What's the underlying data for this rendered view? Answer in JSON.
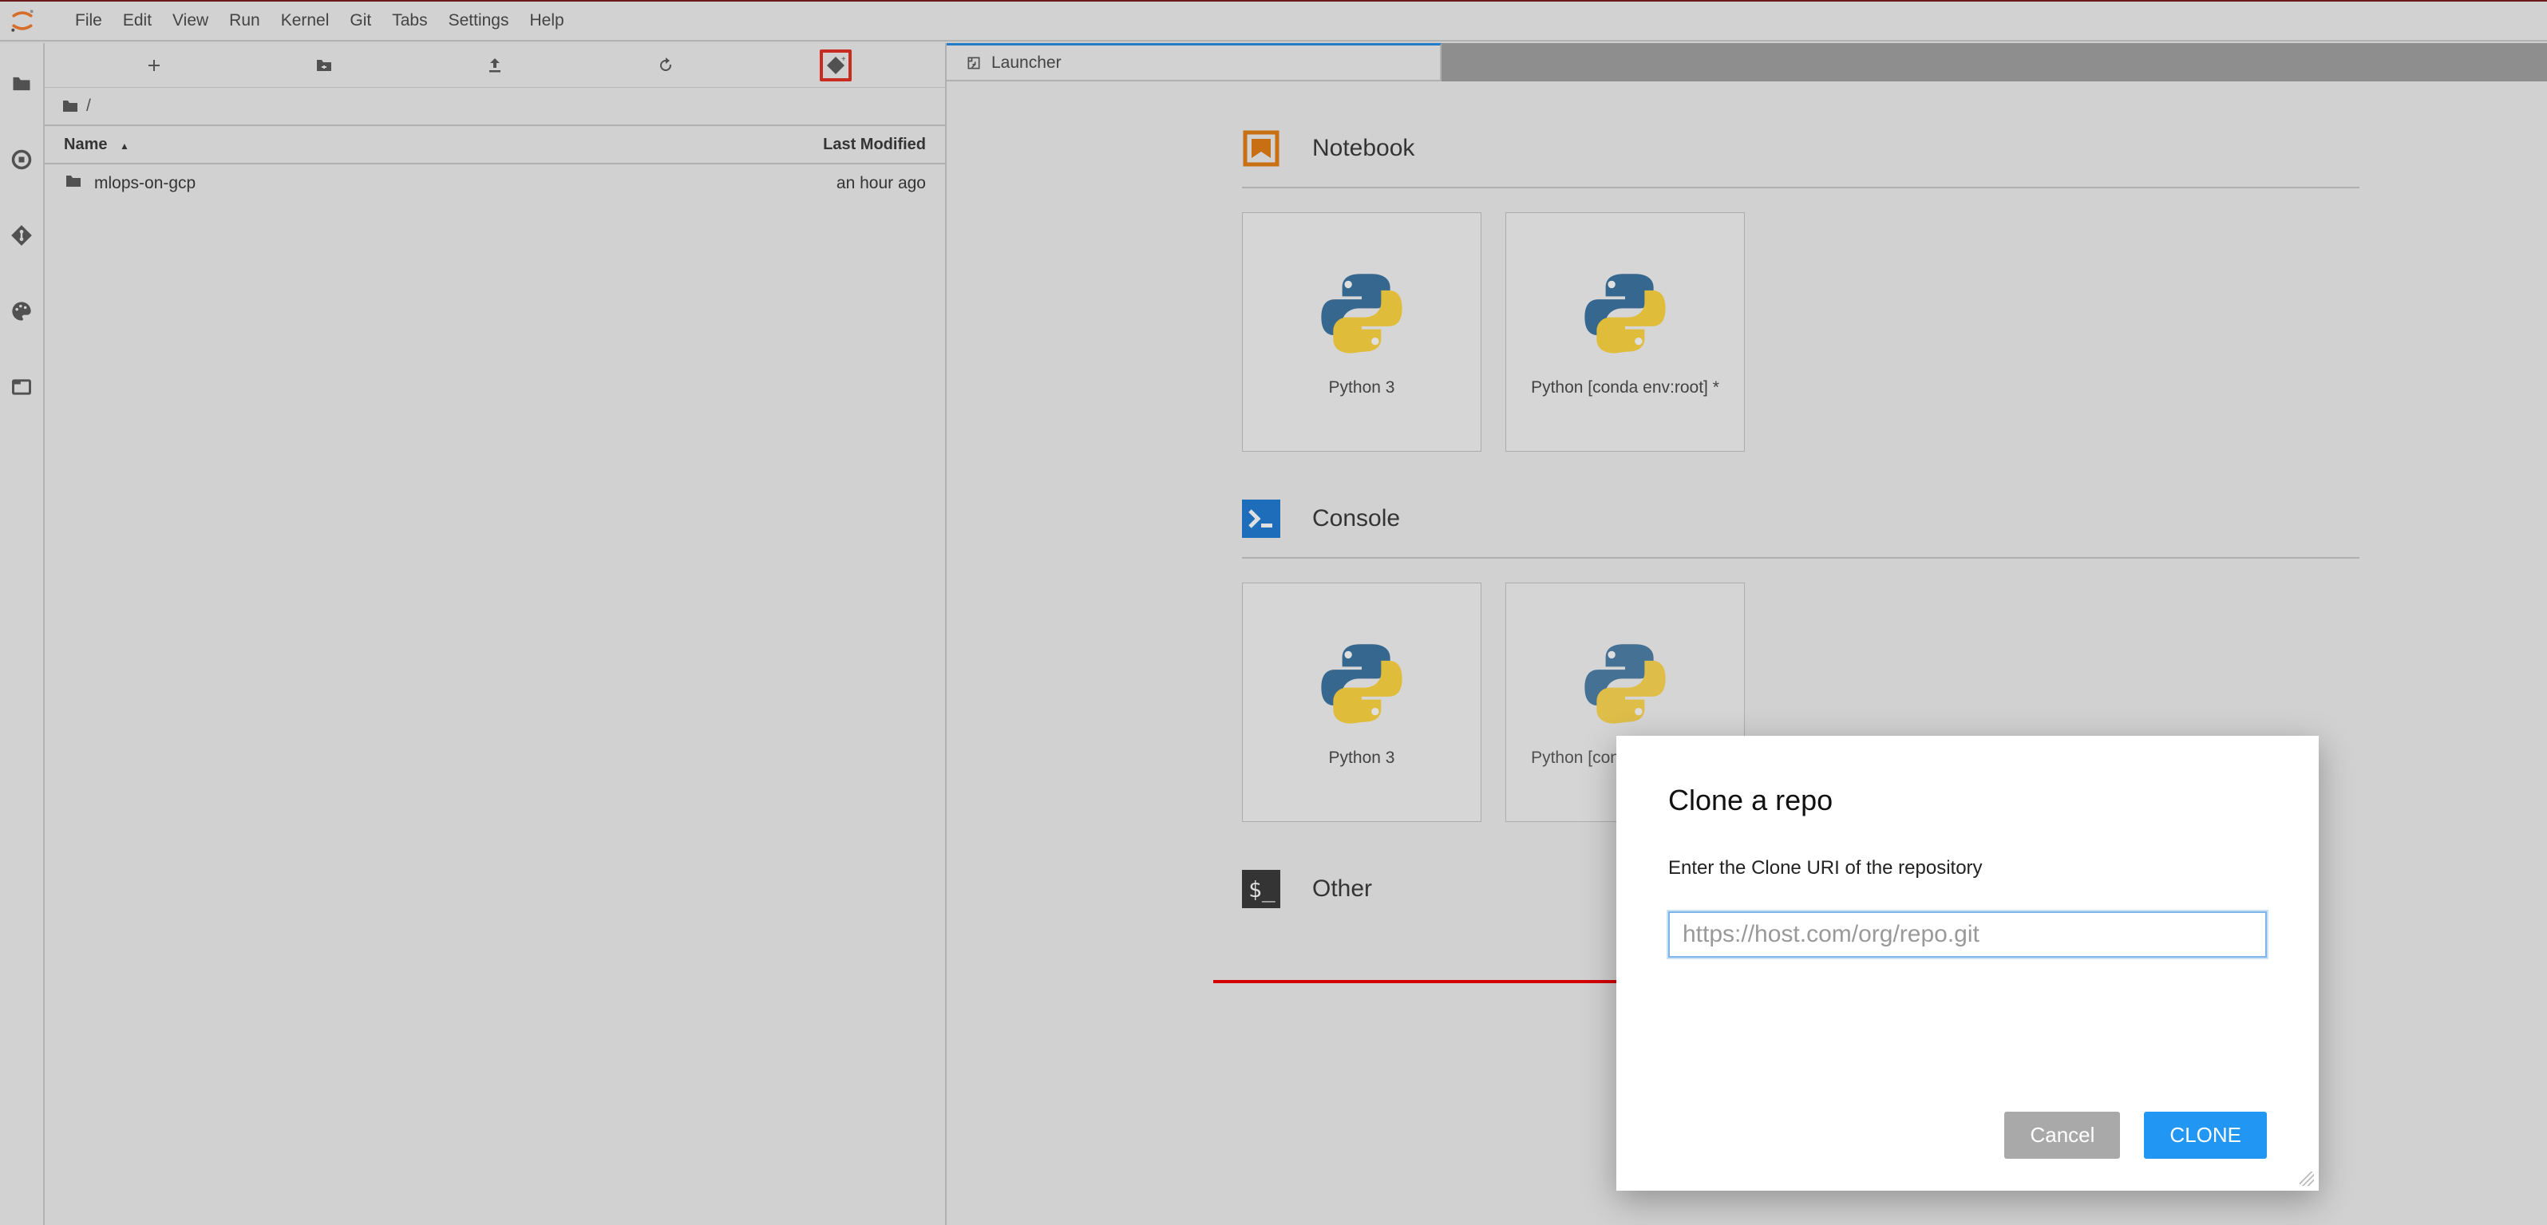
{
  "menubar": {
    "items": [
      "File",
      "Edit",
      "View",
      "Run",
      "Kernel",
      "Git",
      "Tabs",
      "Settings",
      "Help"
    ]
  },
  "filebrowser": {
    "breadcrumb": "/",
    "columns": {
      "name": "Name",
      "modified": "Last Modified"
    },
    "rows": [
      {
        "name": "mlops-on-gcp",
        "modified": "an hour ago"
      }
    ]
  },
  "tab": {
    "title": "Launcher"
  },
  "launcher": {
    "sections": [
      {
        "title": "Notebook",
        "cards": [
          {
            "label": "Python 3"
          },
          {
            "label": "Python [conda env:root] *"
          }
        ]
      },
      {
        "title": "Console",
        "cards": [
          {
            "label": "Python 3"
          },
          {
            "label": "Python [conda env:root] *"
          }
        ]
      },
      {
        "title": "Other",
        "cards": []
      }
    ]
  },
  "dialog": {
    "title": "Clone a repo",
    "label": "Enter the Clone URI of the repository",
    "placeholder": "https://host.com/org/repo.git",
    "cancel": "Cancel",
    "clone": "CLONE"
  },
  "colors": {
    "accent": "#2196f3",
    "tabActiveBorder": "#1e88e5",
    "highlight": "#e3281b",
    "notebookOrange": "#e3780b",
    "consoleBlue": "#1976d2"
  }
}
